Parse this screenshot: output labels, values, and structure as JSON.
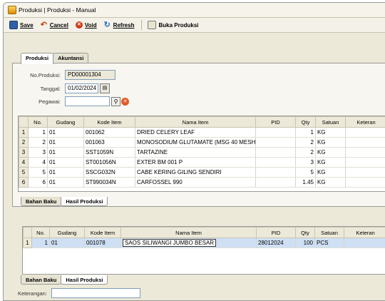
{
  "window": {
    "title": "Produksi | Produksi - Manual"
  },
  "toolbar": {
    "save": "Save",
    "cancel": "Cancel",
    "void": "Void",
    "refresh": "Refresh",
    "buka_produksi": "Buka Produksi"
  },
  "top_tabs": [
    "Produksi",
    "Akuntansi"
  ],
  "form": {
    "no_produksi_label": "No.Produksi:",
    "no_produksi_value": "PD00001304",
    "tanggal_label": "Tanggal:",
    "tanggal_value": "01/02/2024",
    "pegawai_label": "Pegawai:",
    "pegawai_value": ""
  },
  "bahan_grid": {
    "headers": [
      "No.",
      "Gudang",
      "Kode Item",
      "Nama Item",
      "PID",
      "Qty",
      "Satuan",
      "Keteran"
    ],
    "rows": [
      {
        "rh": "1",
        "no": "1",
        "gudang": "01",
        "kode": "001062",
        "nama": "DRIED CELERY LEAF",
        "pid": "",
        "qty": "1",
        "satuan": "KG"
      },
      {
        "rh": "2",
        "no": "2",
        "gudang": "01",
        "kode": "001063",
        "nama": "MONOSODIUM GLUTAMATE (MSG 40 MESH",
        "pid": "",
        "qty": "2",
        "satuan": "KG"
      },
      {
        "rh": "3",
        "no": "3",
        "gudang": "01",
        "kode": "SST1059N",
        "nama": "TARTAZINE",
        "pid": "",
        "qty": "2",
        "satuan": "KG"
      },
      {
        "rh": "4",
        "no": "4",
        "gudang": "01",
        "kode": "ST001056N",
        "nama": "EXTER BM 001 P",
        "pid": "",
        "qty": "3",
        "satuan": "KG"
      },
      {
        "rh": "5",
        "no": "5",
        "gudang": "01",
        "kode": "SSCG032N",
        "nama": "CABE KERING GILING SENDIRI",
        "pid": "",
        "qty": "5",
        "satuan": "KG"
      },
      {
        "rh": "6",
        "no": "6",
        "gudang": "01",
        "kode": "ST990034N",
        "nama": "CARFOSSEL 990",
        "pid": "",
        "qty": "1.45",
        "satuan": "KG"
      }
    ]
  },
  "mid_tabs": [
    "Bahan Baku",
    "Hasil Produksi"
  ],
  "hasil_grid": {
    "headers": [
      "No.",
      "Gudang",
      "Kode Item",
      "Nama Item",
      "PID",
      "Qty",
      "Satuan",
      "Keteran"
    ],
    "rows": [
      {
        "rh": "1",
        "no": "1",
        "gudang": "01",
        "kode": "001078",
        "nama": "SAOS SILIWANGI JUMBO BESAR",
        "pid": "28012024",
        "qty": "100",
        "satuan": "PCS"
      }
    ]
  },
  "bottom_tabs": [
    "Bahan Baku",
    "Hasil Produksi"
  ],
  "footer": {
    "keterangan_label": "Keterangan:",
    "keterangan_value": ""
  }
}
